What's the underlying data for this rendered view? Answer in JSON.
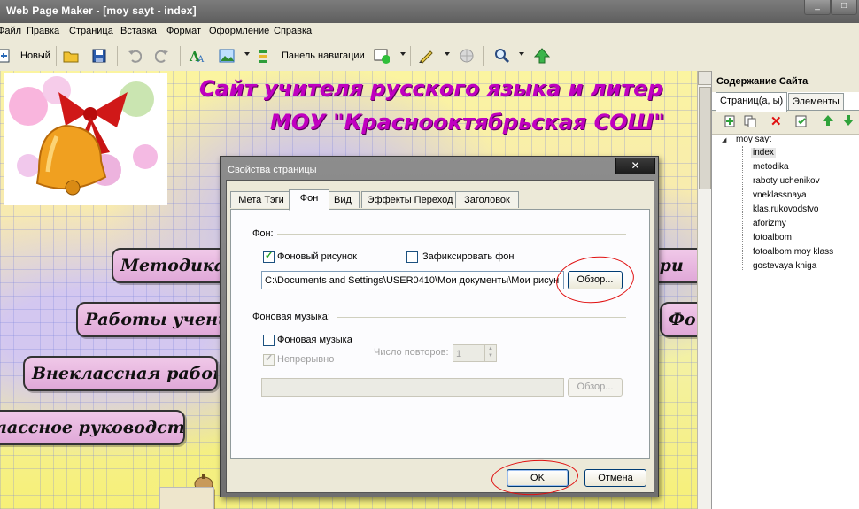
{
  "window": {
    "title": "Web Page Maker - [moy sayt - index]"
  },
  "menu": [
    "Файл",
    "Правка",
    "Страница",
    "Вставка",
    "Формат",
    "Оформление",
    "Справка"
  ],
  "toolbar": {
    "new_label": "Новый",
    "nav_panel_label": "Панель навигации"
  },
  "canvas": {
    "title_line1": "Сайт учителя русского языка и литер",
    "title_line2": "МОУ \"Краснооктябрьская СОШ\"",
    "nav_buttons": [
      "Методика.С",
      "Работы учени",
      "Внеклассная работа",
      "лассное руководство"
    ],
    "nav_right": [
      "ори",
      "Фо"
    ]
  },
  "side_panel": {
    "header": "Содержание Сайта",
    "tabs": [
      "Страниц(а, ы)",
      "Элементы"
    ],
    "root": "moy sayt",
    "pages": [
      "index",
      "metodika",
      "raboty uchenikov",
      "vneklassnaya",
      "klas.rukovodstvo",
      "aforizmy",
      "fotoalbom",
      "fotoalbom moy klass",
      "gostevaya kniga"
    ],
    "selected_page": "index"
  },
  "dialog": {
    "title": "Свойства страницы",
    "close_label": "✕",
    "tabs": [
      "Мета Тэги",
      "Фон",
      "Вид",
      "Эффекты Переход",
      "Заголовок"
    ],
    "active_tab": "Фон",
    "bg_group_label": "Фон:",
    "bg_image_label": "Фоновый рисунок",
    "bg_image_checked": true,
    "fix_bg_label": "Зафиксировать фон",
    "fix_bg_checked": false,
    "bg_path_value": "C:\\Documents and Settings\\USER0410\\Мои документы\\Мои рисун",
    "browse_label": "Обзор...",
    "music_group_label": "Фоновая музыка:",
    "music_label": "Фоновая музыка",
    "music_checked": false,
    "continuous_label": "Непрерывно",
    "continuous_checked": true,
    "repeat_label": "Число повторов:",
    "repeat_value": "1",
    "music_path_value": "",
    "browse2_label": "Обзор...",
    "ok_label": "OK",
    "cancel_label": "Отмена"
  },
  "colors": {
    "title_magenta": "#c000c0",
    "annotation_red": "#e01010",
    "nav_pink": "#e0a8d8"
  }
}
